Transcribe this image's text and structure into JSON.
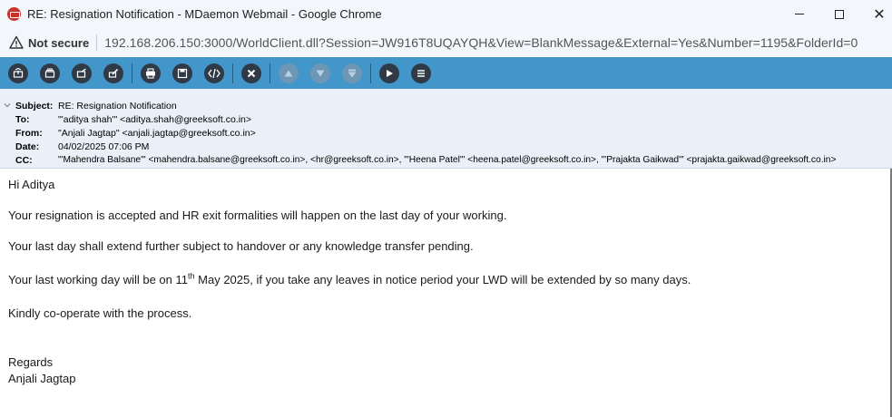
{
  "window": {
    "title": "RE: Resignation Notification - MDaemon Webmail - Google Chrome",
    "minimize_glyph": "",
    "maximize_glyph": "",
    "close_glyph": "✕"
  },
  "addressbar": {
    "security_label": "Not secure",
    "url": "192.168.206.150:3000/WorldClient.dll?Session=JW916T8UQAYQH&View=BlankMessage&External=Yes&Number=1195&FolderId=0"
  },
  "toolbar": {
    "buttons": [
      {
        "name": "reply-icon",
        "enabled": true
      },
      {
        "name": "reply-all-icon",
        "enabled": true
      },
      {
        "name": "forward-icon",
        "enabled": true
      },
      {
        "name": "edit-icon",
        "enabled": true
      },
      {
        "name": "print-icon",
        "enabled": true
      },
      {
        "name": "save-icon",
        "enabled": true
      },
      {
        "name": "view-source-icon",
        "enabled": true
      },
      {
        "name": "delete-icon",
        "enabled": true
      },
      {
        "name": "previous-icon",
        "enabled": false
      },
      {
        "name": "next-icon",
        "enabled": false
      },
      {
        "name": "move-icon",
        "enabled": false
      },
      {
        "name": "play-icon",
        "enabled": true
      },
      {
        "name": "menu-icon",
        "enabled": true
      }
    ],
    "colors": {
      "bar": "#4396c9",
      "button": "#2f3a46",
      "disabled": "#6e96b5"
    }
  },
  "headers": {
    "subject_label": "Subject:",
    "subject": "RE: Resignation Notification",
    "to_label": "To:",
    "to": "\"'aditya shah'\" <aditya.shah@greeksoft.co.in>",
    "from_label": "From:",
    "from": "\"Anjali Jagtap\" <anjali.jagtap@greeksoft.co.in>",
    "date_label": "Date:",
    "date": "04/02/2025 07:06 PM",
    "cc_label": "CC:",
    "cc": "\"'Mahendra Balsane'\" <mahendra.balsane@greeksoft.co.in>, <hr@greeksoft.co.in>, \"'Heena Patel'\" <heena.patel@greeksoft.co.in>, \"'Prajakta Gaikwad'\" <prajakta.gaikwad@greeksoft.co.in>"
  },
  "body": {
    "greeting": "Hi Aditya",
    "line1": "Your resignation is accepted and HR exit formalities will happen on the last day of your working.",
    "line2": "Your last day shall extend further subject to handover or any knowledge transfer pending.",
    "line3_pre": "Your last working day will be on 11",
    "line3_sup": "th",
    "line3_post": " May 2025, if you take any leaves in notice period your LWD will be extended by so many days.",
    "line4": "Kindly co-operate with the process.",
    "regards": "Regards",
    "signature": "Anjali Jagtap"
  }
}
